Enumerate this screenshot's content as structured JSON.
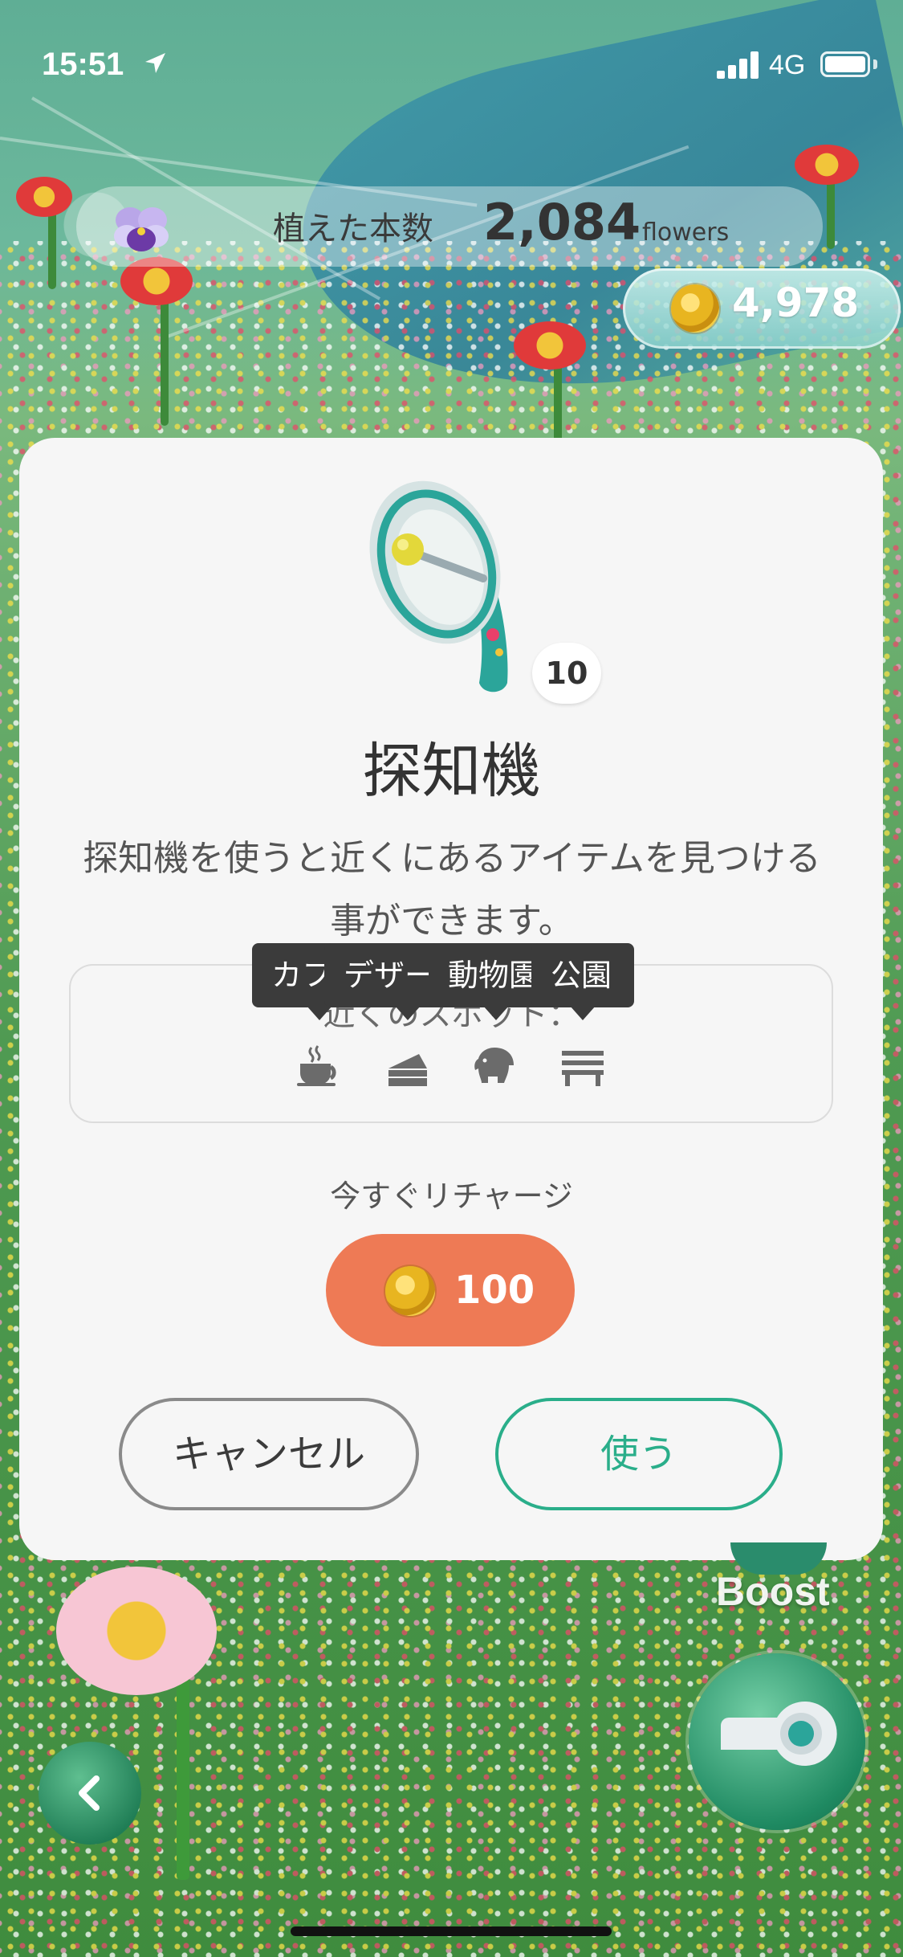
{
  "status_bar": {
    "time": "15:51",
    "network": "4G"
  },
  "header": {
    "planted_label": "植えた本数",
    "planted_count": "2,084",
    "planted_unit": "flowers",
    "coin_balance": "4,978"
  },
  "modal": {
    "item_quantity": "10",
    "title": "探知機",
    "description": "探知機を使うと近くにあるアイテムを見つける事ができます。",
    "spots_label": "近くのスポット：",
    "spots": [
      {
        "icon": "coffee-cup-icon",
        "tooltip": "カフェ"
      },
      {
        "icon": "cake-icon",
        "tooltip": "デザート"
      },
      {
        "icon": "elephant-icon",
        "tooltip": "動物園"
      },
      {
        "icon": "bench-icon",
        "tooltip": "公園"
      }
    ],
    "recharge_label": "今すぐリチャージ",
    "recharge_price": "100",
    "cancel_label": "キャンセル",
    "use_label": "使う"
  },
  "overlay": {
    "boost_label": "Boost"
  },
  "colors": {
    "accent_green": "#2aae8a",
    "recharge_orange": "#ee7a55",
    "modal_background": "#f6f6f6"
  }
}
